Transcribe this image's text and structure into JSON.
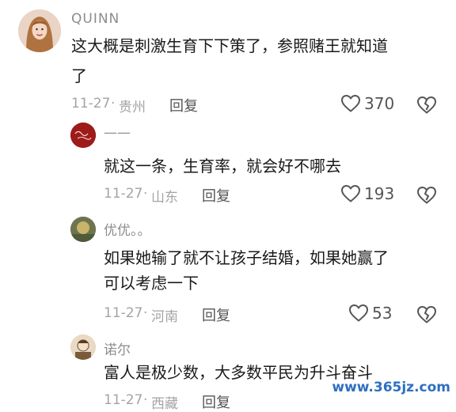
{
  "comments": [
    {
      "username": "QUINN",
      "text_lines": [
        "这大概是刺激生育下下策了，参照赌王就知道",
        "了"
      ],
      "date": "11-27",
      "location": "贵州",
      "reply_label": "回复",
      "likes": "370",
      "avatar_icon": "woman-portrait"
    },
    {
      "username": "——",
      "text_lines": [
        "就这一条，生育率，就会好不哪去"
      ],
      "date": "11-27",
      "location": "山东",
      "reply_label": "回复",
      "likes": "193",
      "avatar_icon": "red-logo-avatar"
    },
    {
      "username": "优优。。",
      "text_lines": [
        "如果她输了就不让孩子结婚，如果她赢了",
        "可以考虑一下"
      ],
      "date": "11-27",
      "location": "河南",
      "reply_label": "回复",
      "likes": "53",
      "avatar_icon": "nature-photo-avatar"
    },
    {
      "username": "诺尔",
      "text_lines": [
        "富人是极少数，大多数平民为升斗奋斗"
      ],
      "date": "11-27",
      "location": "西藏",
      "reply_label": "回复",
      "avatar_icon": "illustrated-avatar"
    }
  ],
  "watermark": "www.365jz.com",
  "colors": {
    "text": "#1a1a1a",
    "muted": "#a4a4a4",
    "icon": "#555555",
    "watermark": "#2e6fc0"
  }
}
